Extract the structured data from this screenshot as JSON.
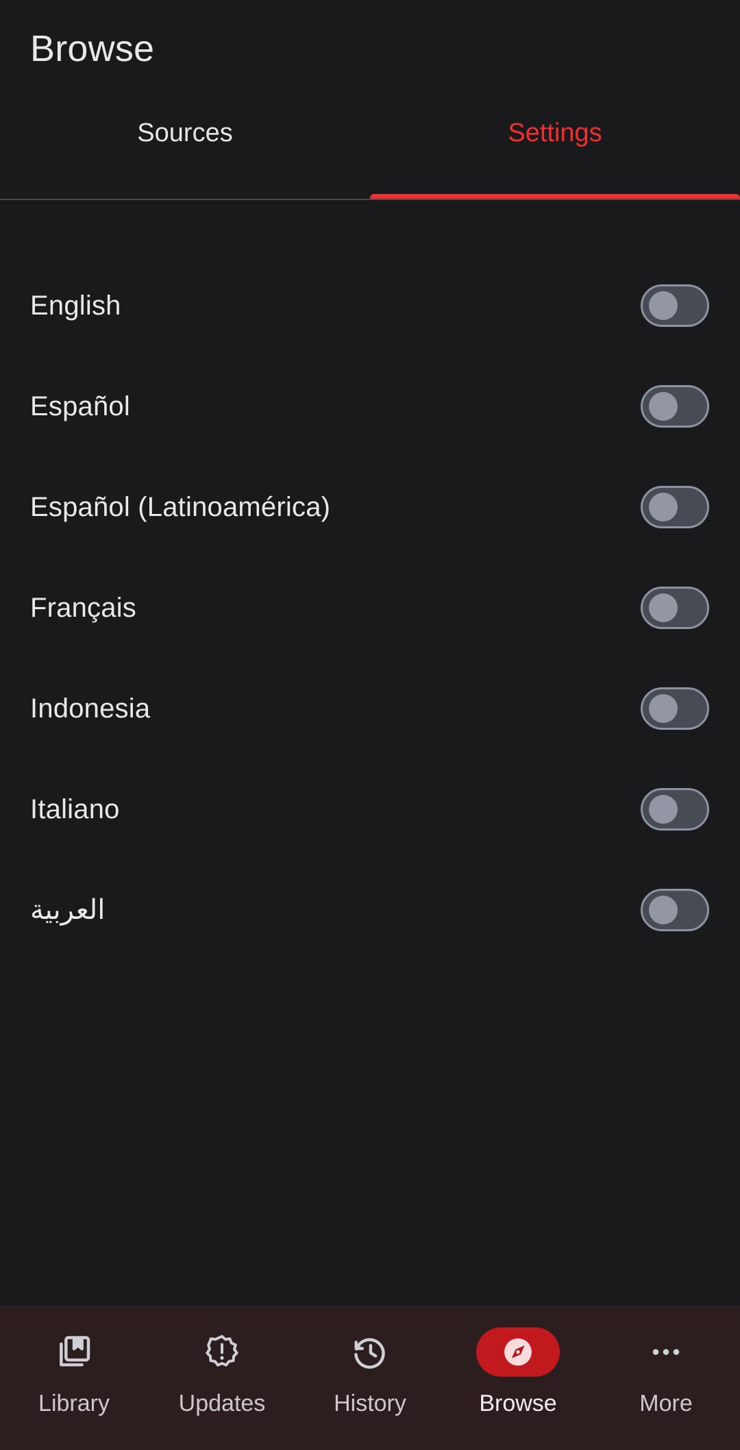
{
  "header": {
    "title": "Browse"
  },
  "tabs": [
    {
      "label": "Sources",
      "active": false
    },
    {
      "label": "Settings",
      "active": true
    }
  ],
  "colors": {
    "accent_red": "#f22f2f",
    "nav_active_pill": "#c2191f",
    "page_background": "#1a1a1c",
    "nav_background": "#2c1e1f",
    "switch_track": "#474b54",
    "switch_border": "#8d93a0",
    "switch_thumb": "#9297a3",
    "text_primary": "#e9e9e9"
  },
  "settings": {
    "languages": [
      {
        "label": "English",
        "enabled": false,
        "rtl": false
      },
      {
        "label": "Español",
        "enabled": false,
        "rtl": false
      },
      {
        "label": "Español (Latinoamérica)",
        "enabled": false,
        "rtl": false
      },
      {
        "label": "Français",
        "enabled": false,
        "rtl": false
      },
      {
        "label": "Indonesia",
        "enabled": false,
        "rtl": false
      },
      {
        "label": "Italiano",
        "enabled": false,
        "rtl": false
      },
      {
        "label": "العربية",
        "enabled": false,
        "rtl": true
      }
    ]
  },
  "bottom_nav": {
    "items": [
      {
        "label": "Library",
        "icon": "collections-bookmark-icon",
        "active": false
      },
      {
        "label": "Updates",
        "icon": "new-releases-icon",
        "active": false
      },
      {
        "label": "History",
        "icon": "history-clock-icon",
        "active": false
      },
      {
        "label": "Browse",
        "icon": "explore-compass-icon",
        "active": true
      },
      {
        "label": "More",
        "icon": "more-horizontal-icon",
        "active": false
      }
    ]
  }
}
